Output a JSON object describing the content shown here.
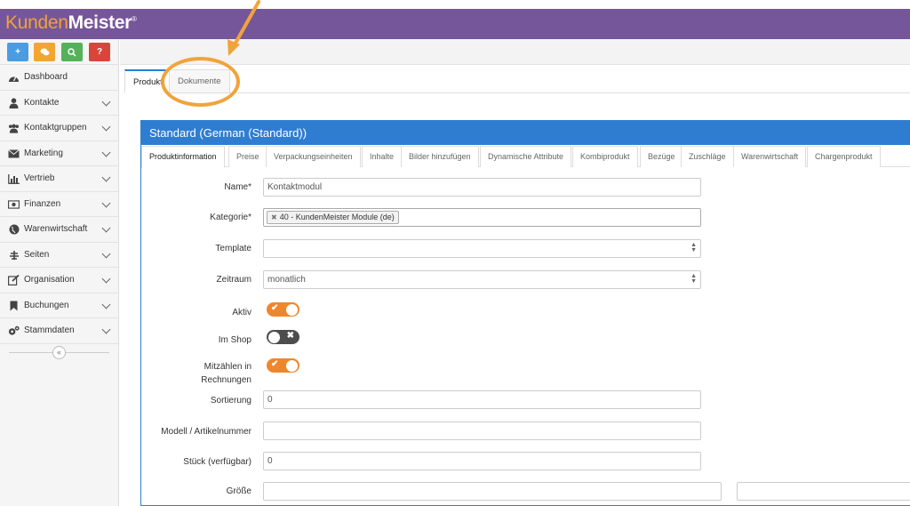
{
  "app": {
    "logo_first": "Kunden",
    "logo_second": "Meister",
    "logo_mark": "®"
  },
  "quick_buttons": [
    {
      "icon": "plus-icon",
      "glyph": "+",
      "color": "#4a9de0"
    },
    {
      "icon": "chat-icon",
      "glyph": "✉",
      "color": "#f3a531"
    },
    {
      "icon": "search-icon",
      "glyph": "⚲",
      "color": "#55b15a"
    },
    {
      "icon": "help-icon",
      "glyph": "?",
      "color": "#d9453a"
    }
  ],
  "sidebar": {
    "items": [
      {
        "label": "Dashboard",
        "icon": "dashboard-icon",
        "chevron": false
      },
      {
        "label": "Kontakte",
        "icon": "user-icon",
        "chevron": true
      },
      {
        "label": "Kontaktgruppen",
        "icon": "users-icon",
        "chevron": true
      },
      {
        "label": "Marketing",
        "icon": "envelope-icon",
        "chevron": true
      },
      {
        "label": "Vertrieb",
        "icon": "bar-chart-icon",
        "chevron": true
      },
      {
        "label": "Finanzen",
        "icon": "money-icon",
        "chevron": true
      },
      {
        "label": "Warenwirtschaft",
        "icon": "globe-icon",
        "chevron": true
      },
      {
        "label": "Seiten",
        "icon": "sitemap-icon",
        "chevron": true
      },
      {
        "label": "Organisation",
        "icon": "edit-icon",
        "chevron": true
      },
      {
        "label": "Buchungen",
        "icon": "bookmark-icon",
        "chevron": true
      },
      {
        "label": "Stammdaten",
        "icon": "gears-icon",
        "chevron": true
      }
    ],
    "collapse_glyph": "«"
  },
  "outer_tabs": [
    {
      "label": "Produkt",
      "active": true
    },
    {
      "label": "Dokumente",
      "active": false
    }
  ],
  "panel": {
    "title": "Standard (German (Standard))",
    "tabs": [
      {
        "label": "Produktinformation",
        "active": true
      },
      {
        "label": "Preise"
      },
      {
        "label": "Verpackungseinheiten"
      },
      {
        "label": "Inhalte"
      },
      {
        "label": "Bilder hinzufügen"
      },
      {
        "label": "Dynamische Attribute"
      },
      {
        "label": "Kombiprodukt"
      },
      {
        "label": "Bezüge"
      },
      {
        "label": "Zuschläge"
      },
      {
        "label": "Warenwirtschaft"
      },
      {
        "label": "Chargenprodukt"
      }
    ]
  },
  "form": {
    "name_label": "Name*",
    "name_value": "Kontaktmodul",
    "kategorie_label": "Kategorie*",
    "kategorie_tag": "40 - KundenMeister Module (de)",
    "template_label": "Template",
    "template_value": "",
    "zeitraum_label": "Zeitraum",
    "zeitraum_value": "monatlich",
    "aktiv_label": "Aktiv",
    "aktiv_on": true,
    "imshop_label": "Im Shop",
    "imshop_on": false,
    "mitzaehlen_label_1": "Mitzählen in",
    "mitzaehlen_label_2": "Rechnungen",
    "mitzaehlen_on": true,
    "sortierung_label": "Sortierung",
    "sortierung_value": "0",
    "modell_label": "Modell / Artikelnummer",
    "modell_value": "",
    "stueck_label": "Stück (verfügbar)",
    "stueck_value": "0",
    "groesse_label": "Größe",
    "groesse_value_1": "",
    "groesse_value_2": ""
  },
  "colors": {
    "brand_purple": "#76569a",
    "logo_orange": "#f0a23a",
    "panel_blue": "#2f7dd1",
    "toggle_on": "#f0862c",
    "toggle_off": "#4d4d4d",
    "annotation_orange": "#f2a33a"
  }
}
